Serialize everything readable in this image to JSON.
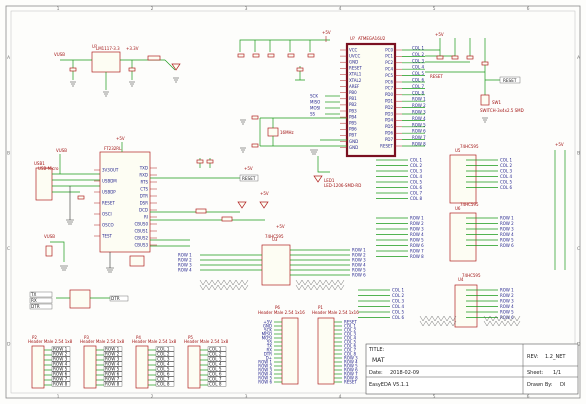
{
  "title_block": {
    "title_label": "TITLE:",
    "title_value": "MAT",
    "rev_label": "REV:",
    "rev_value": "1.2_NET",
    "date_label": "Date:",
    "date_value": "2018-02-09",
    "sheet_label": "Sheet:",
    "sheet_value": "1/1",
    "company": "EasyEDA V5.1.1",
    "drawn_label": "Drawn By:",
    "drawn_value": "DI"
  },
  "zones": {
    "top": [
      "1",
      "2",
      "3",
      "4",
      "5",
      "6"
    ],
    "side": [
      "A",
      "B",
      "C",
      "D"
    ]
  },
  "components": {
    "mcu": {
      "ref": "U?",
      "name": "ATMEGA16U2",
      "pins_left": [
        "VCC",
        "UVCC",
        "GND",
        "RESET",
        "XTAL1",
        "XTAL2",
        "AREF",
        "PB0",
        "PB1",
        "PB2",
        "PB3",
        "PB4",
        "PB5",
        "PB6",
        "PB7",
        "GND",
        "GND"
      ],
      "pins_right": [
        "PC0",
        "PC1",
        "PC2",
        "PC4",
        "PC5",
        "PC6",
        "PC7",
        "PD0",
        "PD1",
        "PD2",
        "PD3",
        "PD4",
        "PD5",
        "PD6",
        "PD7",
        "RESET"
      ]
    },
    "reg": {
      "ref": "U?",
      "name": "LM1117-3.3"
    },
    "usb": {
      "ref": "USB1",
      "name": "USB-Micro"
    },
    "ftdi": {
      "ref": "U?",
      "name": "FT232RL",
      "pins_left": [
        "3V3OUT",
        "USBDM",
        "USBDP",
        "RESET",
        "OSCI",
        "OSCO",
        "TEST"
      ],
      "pins_right": [
        "TXD",
        "RXD",
        "RTS",
        "CTS",
        "DTR",
        "DSR",
        "DCD",
        "RI",
        "CBUS0",
        "CBUS1",
        "CBUS2",
        "CBUS3"
      ]
    },
    "u3": {
      "ref": "U3",
      "name": "74HC595"
    },
    "u4": {
      "ref": "U4",
      "name": "74HC595"
    },
    "u5": {
      "ref": "U5",
      "name": "74HC595"
    },
    "u6": {
      "ref": "U6",
      "name": "74HC595"
    },
    "crystal": {
      "ref": "X1",
      "name": "16MHz"
    },
    "switch": {
      "ref": "SW1",
      "name": "SWITCH-3x4x2.5 SMD"
    },
    "led": {
      "ref": "LED1",
      "name": "LED-1206-SMD-RD"
    },
    "header_p1": {
      "ref": "P1",
      "name": "Header Male 2.54 1x16"
    },
    "header_p2": {
      "ref": "P2",
      "name": "Header Male 2.54 1x8"
    },
    "header_p3": {
      "ref": "P3",
      "name": "Header Male 2.54 1x8"
    },
    "header_p4": {
      "ref": "P4",
      "name": "Header Male 2.54 1x8"
    },
    "header_p5": {
      "ref": "P5",
      "name": "Header Male 2.54 1x8"
    },
    "header_p6": {
      "ref": "P6",
      "name": "Header Male 2.54 1x16"
    }
  },
  "nets": {
    "reset": "RESET",
    "vcc": "+5V",
    "v33": "+3.3V",
    "gnd": "GND",
    "vusb": "VUSB",
    "row": [
      "ROW 1",
      "ROW 2",
      "ROW 3",
      "ROW 4",
      "ROW 5",
      "ROW 6",
      "ROW 7",
      "ROW 8"
    ],
    "col": [
      "COL 1",
      "COL 2",
      "COL 3",
      "COL 4",
      "COL 5",
      "COL 6",
      "COL 7",
      "COL 8"
    ],
    "misc": [
      "SCK",
      "MISO",
      "MOSI",
      "SS",
      "TX",
      "RX",
      "DTR",
      "D+",
      "D-"
    ]
  }
}
